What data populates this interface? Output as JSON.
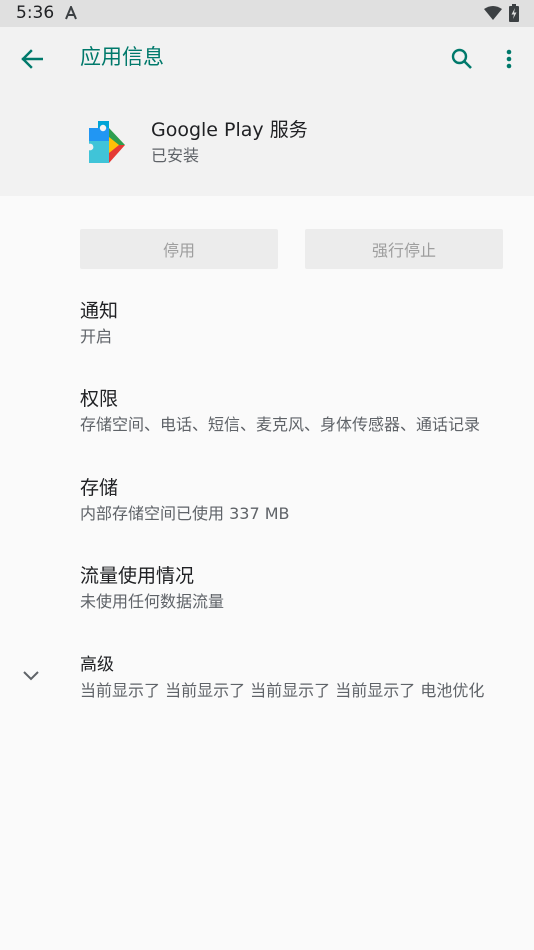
{
  "status_bar": {
    "time": "5:36",
    "notification_icon": "android-a-icon",
    "wifi_icon": "wifi-icon",
    "battery_icon": "battery-charging-icon"
  },
  "toolbar": {
    "title": "应用信息",
    "back_icon": "arrow-back-icon",
    "search_icon": "search-icon",
    "more_icon": "more-vert-icon"
  },
  "app": {
    "name": "Google Play 服务",
    "status": "已安装",
    "icon": "google-play-services-icon"
  },
  "buttons": {
    "disable": "停用",
    "force_stop": "强行停止"
  },
  "settings": [
    {
      "title": "通知",
      "summary": "开启"
    },
    {
      "title": "权限",
      "summary": "存储空间、电话、短信、麦克风、身体传感器、通话记录"
    },
    {
      "title": "存储",
      "summary": "内部存储空间已使用 337 MB"
    },
    {
      "title": "流量使用情况",
      "summary": "未使用任何数据流量"
    },
    {
      "title": "高级",
      "summary": "当前显示了 当前显示了 当前显示了 当前显示了 电池优化"
    }
  ],
  "colors": {
    "accent": "#00796b",
    "status_bar": "#e0e0e0",
    "header": "#f2f2f2",
    "background": "#fafafa"
  }
}
